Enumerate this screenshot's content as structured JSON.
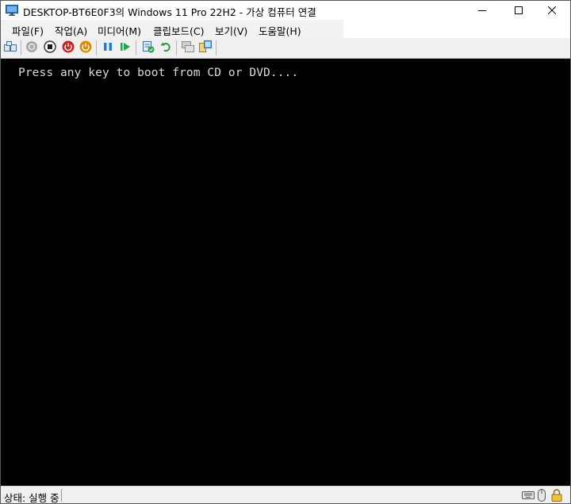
{
  "window": {
    "title": "DESKTOP-BT6E0F3의 Windows 11 Pro 22H2 - 가상 컴퓨터 연결",
    "app_icon": "vm-monitor-icon"
  },
  "caption_buttons": [
    {
      "name": "minimize-button",
      "icon": "minimize-icon"
    },
    {
      "name": "maximize-button",
      "icon": "maximize-icon"
    },
    {
      "name": "close-button",
      "icon": "close-icon"
    }
  ],
  "menu": {
    "items": [
      "파일(F)",
      "작업(A)",
      "미디어(M)",
      "클립보드(C)",
      "보기(V)",
      "도움말(H)"
    ]
  },
  "toolbar": {
    "buttons": [
      {
        "name": "ctrl-alt-del-button",
        "icon": "keyboard-icon"
      },
      {
        "name": "start-button",
        "icon": "start-icon",
        "disabled": true
      },
      {
        "name": "turn-off-button",
        "icon": "stop-icon"
      },
      {
        "name": "shut-down-button",
        "icon": "shutdown-icon"
      },
      {
        "name": "save-button",
        "icon": "save-state-icon"
      },
      {
        "name": "pause-button",
        "icon": "pause-icon"
      },
      {
        "name": "resume-button",
        "icon": "resume-icon"
      },
      {
        "name": "checkpoint-button",
        "icon": "checkpoint-icon"
      },
      {
        "name": "revert-button",
        "icon": "revert-icon"
      },
      {
        "name": "enhanced-session-button",
        "icon": "enhanced-session-icon",
        "disabled": true
      },
      {
        "name": "share-button",
        "icon": "share-icon"
      }
    ],
    "colors": {
      "blue": "#1a7fd6",
      "green": "#1fa54a",
      "red": "#d21f1f",
      "orange": "#e08a00",
      "gray": "#9b9b9b"
    }
  },
  "console": {
    "text": "Press any key to boot from CD or DVD....",
    "background": "#000000",
    "foreground": "#d9d9d9"
  },
  "status": {
    "text": "상태: 실행 중",
    "icons": [
      "keyboard-icon",
      "mouse-icon",
      "lock-icon"
    ]
  }
}
